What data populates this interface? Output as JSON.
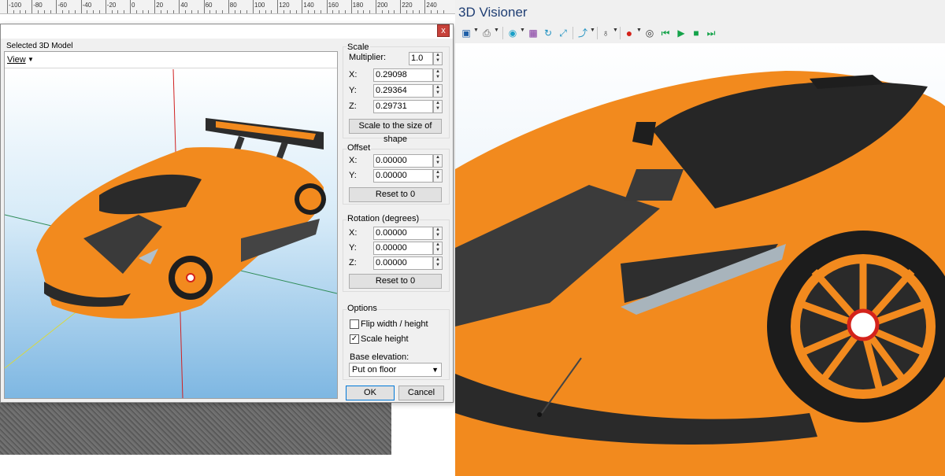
{
  "ruler": {
    "ticks": [
      "-100",
      "-80",
      "-60",
      "-40",
      "-20",
      "0",
      "20",
      "40",
      "60",
      "80",
      "100",
      "120",
      "140",
      "160",
      "180",
      "200",
      "220",
      "240"
    ]
  },
  "dialog": {
    "close_glyph": "x",
    "preview": {
      "title": "Selected 3D Model",
      "view_menu": "View"
    },
    "scale": {
      "title": "Scale",
      "multiplier_label": "Multiplier:",
      "multiplier": "1.0",
      "x_label": "X:",
      "x": "0.29098",
      "y_label": "Y:",
      "y": "0.29364",
      "z_label": "Z:",
      "z": "0.29731",
      "button": "Scale to the size of shape"
    },
    "offset": {
      "title": "Offset",
      "x_label": "X:",
      "x": "0.00000",
      "y_label": "Y:",
      "y": "0.00000",
      "reset": "Reset to 0"
    },
    "rotation": {
      "title": "Rotation (degrees)",
      "x_label": "X:",
      "x": "0.00000",
      "y_label": "Y:",
      "y": "0.00000",
      "z_label": "Z:",
      "z": "0.00000",
      "reset": "Reset to 0"
    },
    "options": {
      "title": "Options",
      "flip_label": "Flip width / height",
      "flip_checked": false,
      "scale_height_label": "Scale height",
      "scale_height_checked": true,
      "base_elevation_label": "Base elevation:",
      "base_elevation_value": "Put on floor"
    },
    "ok": "OK",
    "cancel": "Cancel"
  },
  "visioner": {
    "title": "3D Visioner",
    "toolbar_icons": [
      "save-icon",
      "print-icon",
      "camera-icon",
      "grid-view-icon",
      "orbit-icon",
      "fit-view-icon",
      "path-icon",
      "light-bulb-icon",
      "record-icon",
      "eye-icon",
      "skip-start-icon",
      "play-icon",
      "stop-icon",
      "skip-end-icon"
    ]
  },
  "colors": {
    "car_orange": "#f28a1e",
    "accent_blue": "#1f3e73",
    "record_red": "#d4231b",
    "media_green": "#15a34a"
  }
}
